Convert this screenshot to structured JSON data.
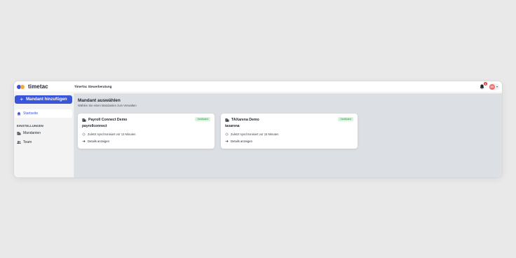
{
  "app": {
    "logo_text": "timetac",
    "title": "TimeTac Steuerberatung",
    "notifications_count": "3",
    "user_initials": "SG"
  },
  "sidebar": {
    "add_button_label": "Mandant hinzufügen",
    "home_label": "Startseite",
    "section_label": "EINSTELLUNGEN",
    "items": [
      {
        "label": "Mandanten",
        "icon": "building-icon"
      },
      {
        "label": "Team",
        "icon": "people-icon"
      }
    ]
  },
  "main": {
    "title": "Mandant auswählen",
    "subtitle": "Wählen Sie einen Mandanten zum Verwalten",
    "cards": [
      {
        "name": "Payroll Connect Demo",
        "slug": "payrollconnect",
        "badge": "Verifiziert",
        "sync_text": "Zuletzt synchronisiert vor 13 Minuten",
        "details_label": "Details anzeigen"
      },
      {
        "name": "TAXarena Demo",
        "slug": "taxarena",
        "badge": "Verifiziert",
        "sync_text": "Zuletzt synchronisiert vor 15 Minuten",
        "details_label": "Details anzeigen"
      }
    ]
  },
  "colors": {
    "accent": "#3a55d9",
    "badge_bg": "#d9f2dd",
    "badge_text": "#2e8b45",
    "notification": "#e53935"
  }
}
